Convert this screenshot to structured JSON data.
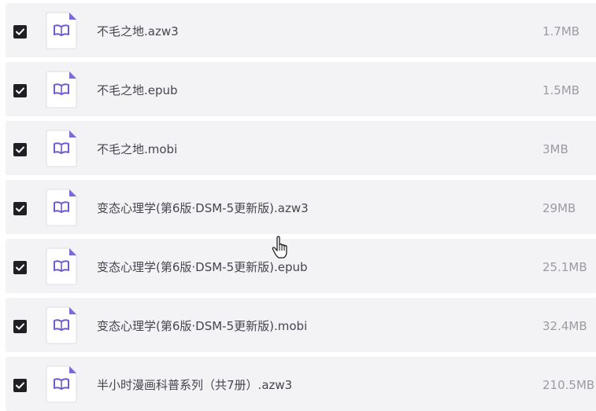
{
  "accent_color": "#6d5bd0",
  "icons": {
    "checkbox": "checkbox-checked-icon",
    "file": "ebook-file-icon",
    "cursor": "hand-pointer-icon"
  },
  "files": [
    {
      "name": "不毛之地.azw3",
      "size": "1.7MB",
      "checked": true
    },
    {
      "name": "不毛之地.epub",
      "size": "1.5MB",
      "checked": true
    },
    {
      "name": "不毛之地.mobi",
      "size": "3MB",
      "checked": true
    },
    {
      "name": "变态心理学(第6版·DSM-5更新版).azw3",
      "size": "29MB",
      "checked": true
    },
    {
      "name": "变态心理学(第6版·DSM-5更新版).epub",
      "size": "25.1MB",
      "checked": true
    },
    {
      "name": "变态心理学(第6版·DSM-5更新版).mobi",
      "size": "32.4MB",
      "checked": true
    },
    {
      "name": "半小时漫画科普系列（共7册）.azw3",
      "size": "210.5MB",
      "checked": true
    }
  ]
}
